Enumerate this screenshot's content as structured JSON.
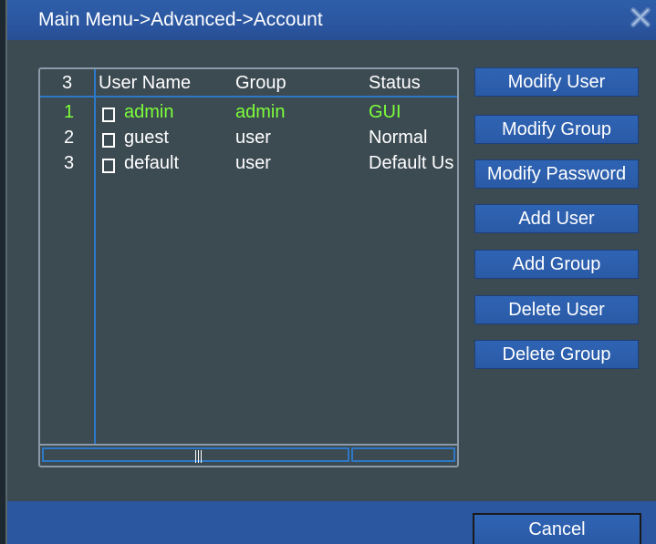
{
  "window": {
    "title": "Main Menu->Advanced->Account",
    "close_icon": "close-icon"
  },
  "table": {
    "count_header": "3",
    "columns": [
      "User Name",
      "Group",
      "Status"
    ],
    "rows": [
      {
        "index": "1",
        "user_name": "admin",
        "group": "admin",
        "status": "GUI",
        "active": true,
        "checked": false
      },
      {
        "index": "2",
        "user_name": "guest",
        "group": "user",
        "status": "Normal",
        "active": false,
        "checked": false
      },
      {
        "index": "3",
        "user_name": "default",
        "group": "user",
        "status": "Default Us",
        "active": false,
        "checked": false
      }
    ]
  },
  "buttons": {
    "modify_user": "Modify User",
    "modify_group": "Modify Group",
    "modify_password": "Modify Password",
    "add_user": "Add User",
    "add_group": "Add Group",
    "delete_user": "Delete User",
    "delete_group": "Delete Group",
    "cancel": "Cancel"
  },
  "colors": {
    "title_bar": "#2b56a0",
    "panel_bg": "#3c4a52",
    "active_row_text": "#7cff3a",
    "accent_line": "#2e78c8"
  }
}
